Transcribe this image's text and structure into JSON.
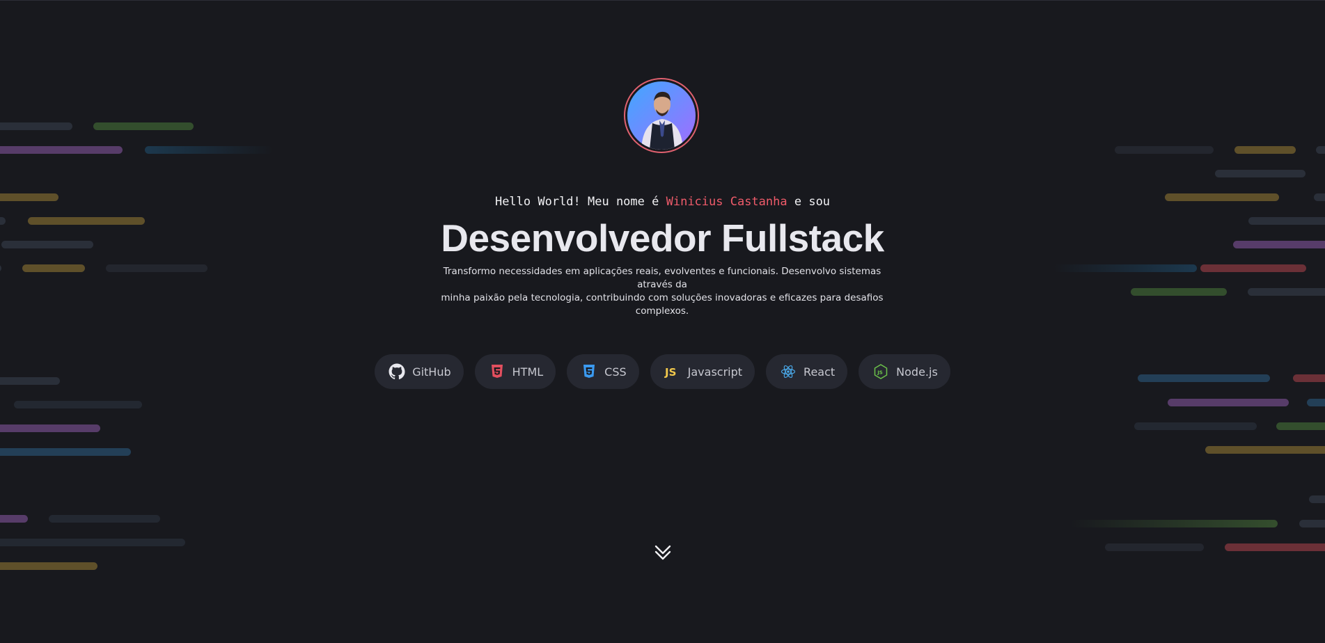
{
  "greeting": {
    "prefix": "Hello World! Meu nome é",
    "name": "Winicius Castanha",
    "suffix": "e sou"
  },
  "title": "Desenvolvedor Fullstack",
  "subtitle_line1": "Transformo necessidades em aplicações reais, evolventes e funcionais. Desenvolvo sistemas através da",
  "subtitle_line2": "minha paixão pela tecnologia, contribuindo com soluções inovadoras e eficazes para desafios complexos.",
  "techs": [
    {
      "label": "GitHub",
      "icon": "github-icon"
    },
    {
      "label": "HTML",
      "icon": "html5-icon"
    },
    {
      "label": "CSS",
      "icon": "css3-icon"
    },
    {
      "label": "Javascript",
      "icon": "js-icon"
    },
    {
      "label": "React",
      "icon": "react-icon"
    },
    {
      "label": "Node.js",
      "icon": "nodejs-icon"
    }
  ],
  "colors": {
    "background": "#18191e",
    "accent": "#ef5b6a",
    "chip": "#262831"
  },
  "scroll_icon": "chevron-double-down-icon",
  "avatar": "profile-photo"
}
